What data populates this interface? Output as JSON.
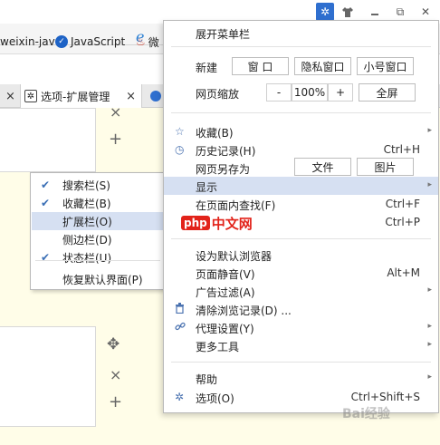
{
  "window": {
    "buttons": [
      {
        "icon": "gear-icon",
        "glyph": "✲"
      },
      {
        "icon": "shirt-icon",
        "glyph": "👕"
      },
      {
        "icon": "restore-icon",
        "glyph": "⧉"
      },
      {
        "icon": "close-icon",
        "glyph": "✕"
      }
    ]
  },
  "bookmarks": {
    "items": [
      "weixin-jav",
      "JavaScript",
      "微"
    ]
  },
  "tabs": {
    "active_label": "选项-扩展管理",
    "close_glyph": "×"
  },
  "page": {
    "controls": {
      "close": "×",
      "add": "+",
      "move": "✥"
    }
  },
  "submenu": {
    "items": [
      {
        "label": "搜索栏(S)",
        "checked": true
      },
      {
        "label": "收藏栏(B)",
        "checked": true
      },
      {
        "label": "扩展栏(O)",
        "checked": false
      },
      {
        "label": "侧边栏(D)",
        "checked": false
      },
      {
        "label": "状态栏(U)",
        "checked": true
      },
      {
        "label": "恢复默认界面(P)",
        "checked": false
      }
    ],
    "check_glyph": "✔"
  },
  "menu": {
    "expand_menubar": "展开菜单栏",
    "new_label": "新建",
    "new_window": "窗 口",
    "new_private": "隐私窗口",
    "new_small": "小号窗口",
    "zoom_label": "网页缩放",
    "zoom_minus": "-",
    "zoom_value": "100%",
    "zoom_plus": "+",
    "fullscreen": "全屏",
    "favorites": "收藏(B)",
    "history": "历史记录(H)",
    "history_shortcut": "Ctrl+H",
    "save_as": "网页另存为",
    "save_file": "文件",
    "save_image": "图片",
    "display": "显示",
    "find": "在页面内查找(F)",
    "find_shortcut": "Ctrl+F",
    "print_shortcut": "Ctrl+P",
    "set_default": "设为默认浏览器",
    "mute": "页面静音(V)",
    "mute_shortcut": "Alt+M",
    "adblock": "广告过滤(A)",
    "clear_history": "清除浏览记录(D) ...",
    "proxy": "代理设置(Y)",
    "more_tools": "更多工具",
    "help": "帮助",
    "options": "选项(O)",
    "options_shortcut": "Ctrl+Shift+S",
    "arrow_glyph": "▸",
    "star_glyph": "☆",
    "clock_glyph": "◷",
    "trash_glyph": "🗑",
    "link_glyph": "⛓",
    "gear_glyph": "✲"
  },
  "watermark": {
    "php_badge": "php",
    "php_text": "中文网",
    "baidu": "Bai经验"
  },
  "colors": {
    "accent": "#2f6fcf",
    "highlight": "#d6e0f2",
    "content_bg": "#fffde8"
  }
}
